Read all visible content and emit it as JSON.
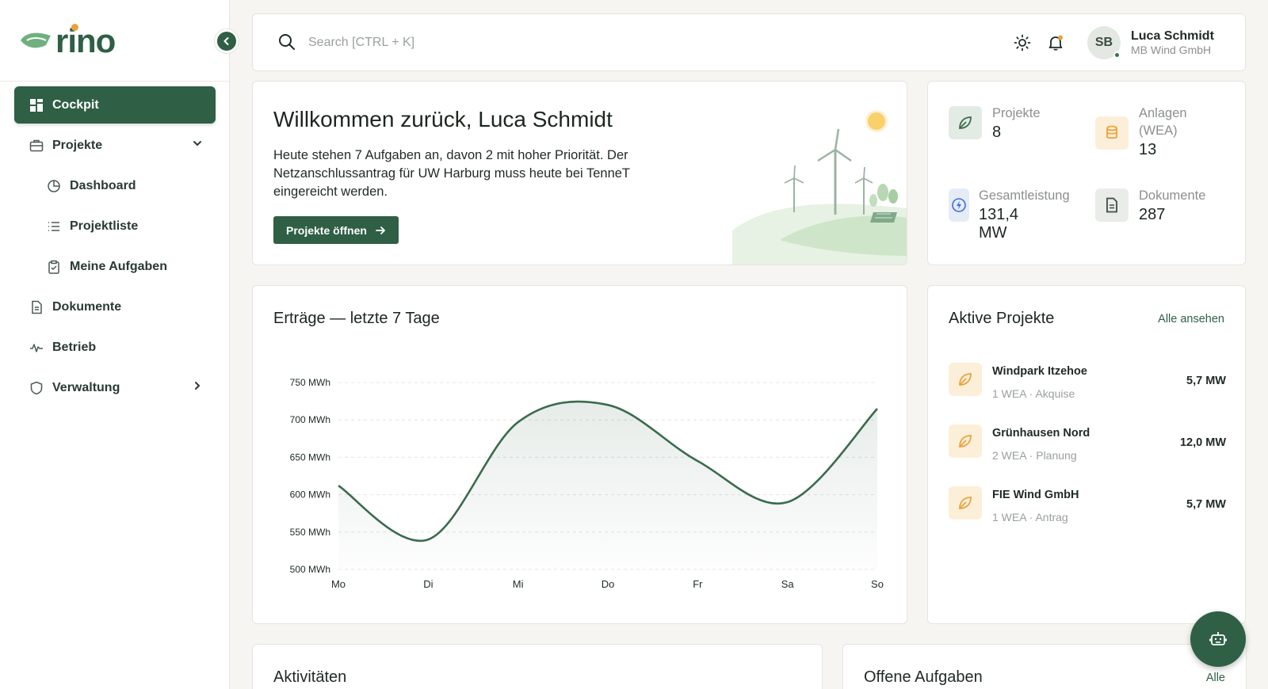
{
  "app": {
    "logo_text": "rino"
  },
  "sidebar": {
    "items": [
      {
        "label": "Cockpit",
        "icon": "grid-icon",
        "active": true
      },
      {
        "label": "Projekte",
        "icon": "briefcase-icon",
        "expanded": true
      },
      {
        "label": "Dashboard",
        "icon": "pie-chart-icon",
        "sub": true
      },
      {
        "label": "Projektliste",
        "icon": "list-icon",
        "sub": true
      },
      {
        "label": "Meine Aufgaben",
        "icon": "clipboard-icon",
        "sub": true
      },
      {
        "label": "Dokumente",
        "icon": "document-icon"
      },
      {
        "label": "Betrieb",
        "icon": "activity-icon"
      },
      {
        "label": "Verwaltung",
        "icon": "shield-icon"
      }
    ]
  },
  "topbar": {
    "search_placeholder": "Search [CTRL + K]",
    "user": {
      "initials": "SB",
      "name": "Luca Schmidt",
      "company": "MB Wind GmbH"
    }
  },
  "welcome": {
    "title": "Willkommen zurück, Luca Schmidt",
    "text": "Heute stehen 7 Aufgaben an, davon 2 mit hoher Priorität. Der Netzanschlussantrag für UW Harburg muss heute bei TenneT eingereicht werden.",
    "button_label": "Projekte öffnen"
  },
  "stats": [
    {
      "label": "Projekte",
      "value": "8",
      "icon": "leaf-icon"
    },
    {
      "label": "Anlagen (WEA)",
      "value": "13",
      "icon": "database-icon"
    },
    {
      "label": "Gesamtleistung",
      "value": "131,4 MW",
      "icon": "bolt-icon"
    },
    {
      "label": "Dokumente",
      "value": "287",
      "icon": "document-icon"
    }
  ],
  "chart": {
    "title": "Erträge — letzte 7 Tage"
  },
  "chart_data": {
    "type": "area",
    "title": "Erträge — letzte 7 Tage",
    "categories": [
      "Mo",
      "Di",
      "Mi",
      "Do",
      "Fr",
      "Sa",
      "So"
    ],
    "values": [
      612,
      540,
      697,
      720,
      645,
      590,
      715
    ],
    "y_ticks": [
      "500 MWh",
      "550 MWh",
      "600 MWh",
      "650 MWh",
      "700 MWh",
      "750 MWh"
    ],
    "ylim": [
      500,
      750
    ],
    "grid": true,
    "color": "#3b6b4e"
  },
  "projects": {
    "title": "Aktive Projekte",
    "see_all": "Alle ansehen",
    "items": [
      {
        "name": "Windpark Itzehoe",
        "meta": "1 WEA · Akquise",
        "value": "5,7 MW"
      },
      {
        "name": "Grünhausen Nord",
        "meta": "2 WEA · Planung",
        "value": "12,0 MW"
      },
      {
        "name": "FIE Wind GmbH",
        "meta": "1 WEA · Antrag",
        "value": "5,7 MW"
      }
    ]
  },
  "activities": {
    "title": "Aktivitäten"
  },
  "tasks": {
    "title": "Offene Aufgaben",
    "see_all": "Alle"
  },
  "colors": {
    "brand": "#2f5f45",
    "accent_orange": "#e8a33c",
    "background": "#f6f5f1"
  }
}
